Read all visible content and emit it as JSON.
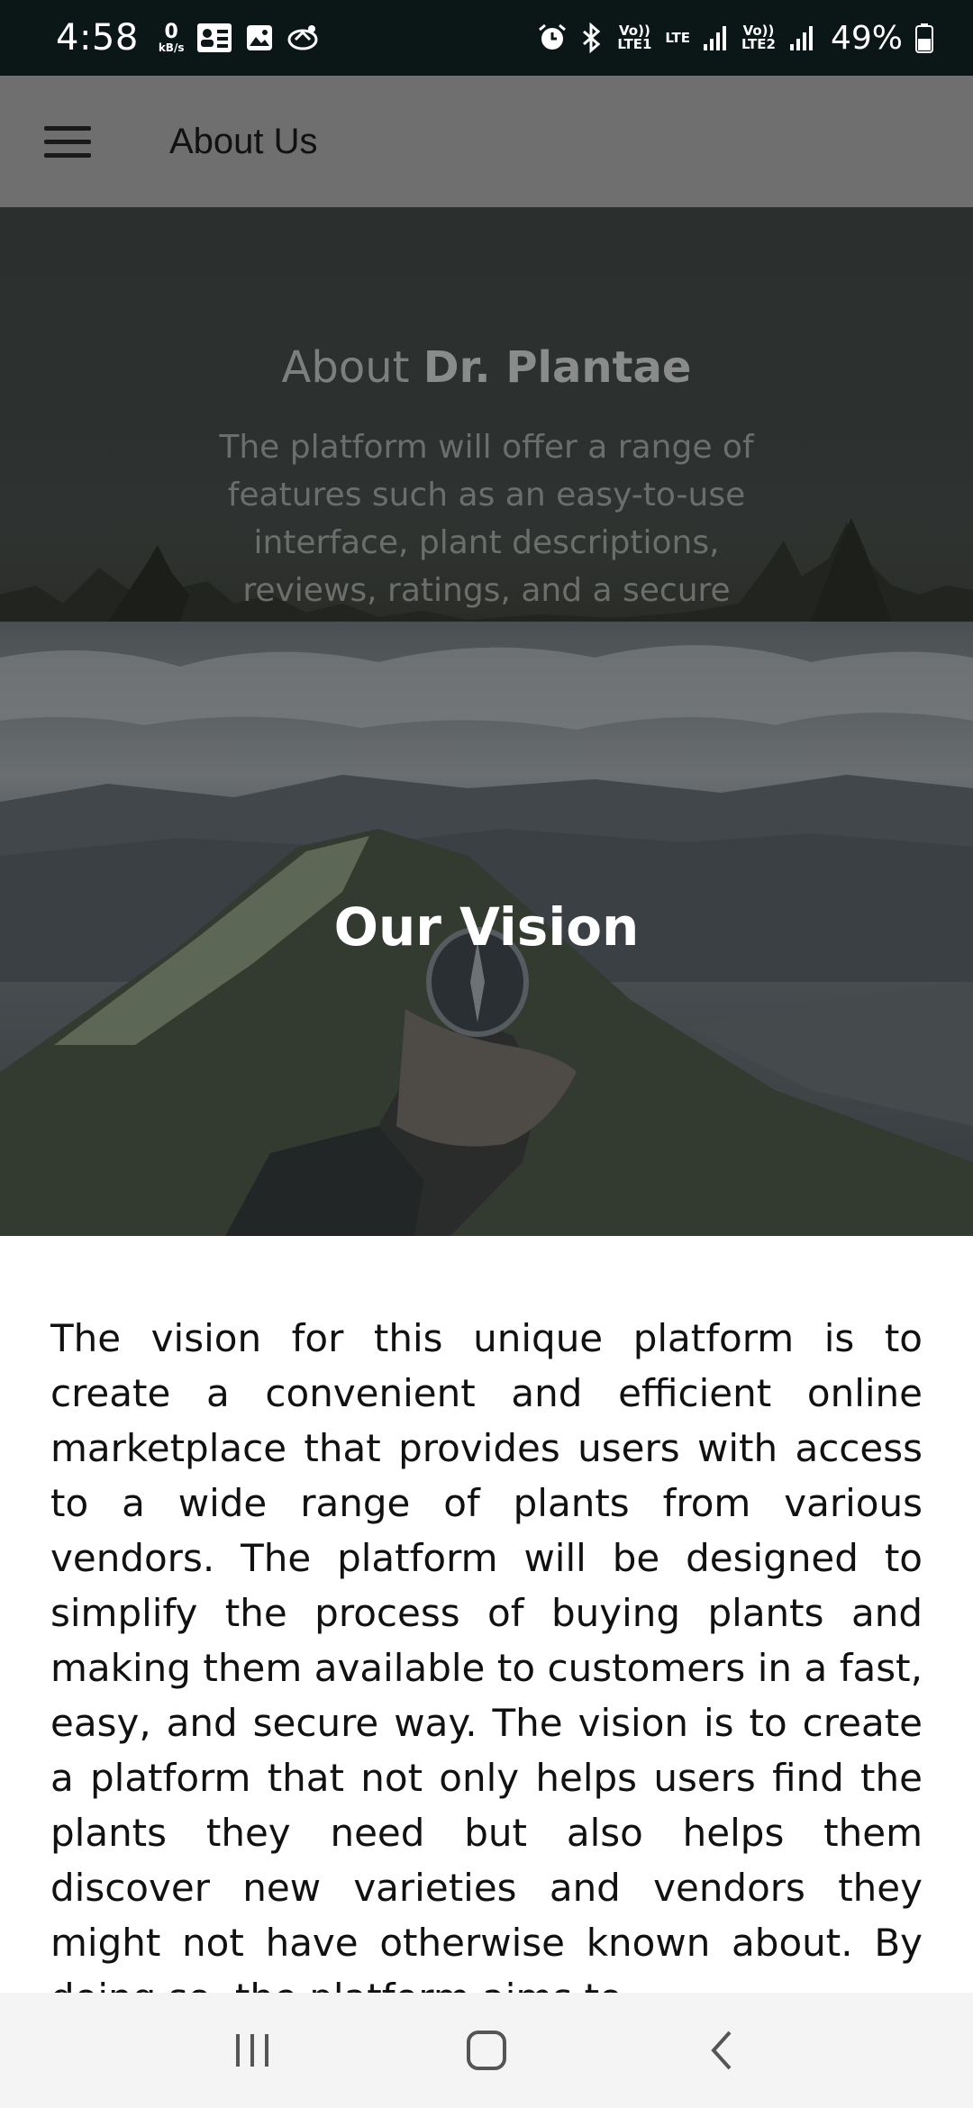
{
  "status_bar": {
    "time": "4:58",
    "speed_value": "0",
    "speed_unit": "kB/s",
    "lte1": "Vo)) LTE1",
    "lte_label": "LTE",
    "lte2": "Vo)) LTE2",
    "battery": "49%"
  },
  "app_bar": {
    "title": "About Us",
    "menu_icon": "hamburger-menu-icon"
  },
  "about_section": {
    "heading_prefix": "About",
    "heading_brand": "Dr. Plantae",
    "description": "The platform will offer a range of features such as an easy-to-use interface, plant descriptions, reviews, ratings, and a secure"
  },
  "vision_section": {
    "title": "Our Vision",
    "body": "The vision for this unique platform is to create a convenient and efficient online marketplace that provides users with access to a wide range of plants from various vendors. The platform will be designed to simplify the process of buying plants and making them available to customers in a fast, easy, and secure way. The vision is to create a platform that not only helps users find the plants they need but also helps them discover new varieties and vendors they might not have otherwise known about. By doing so, the platform aims to"
  },
  "nav_bar": {
    "recents_icon": "recents-icon",
    "home_icon": "home-icon",
    "back_icon": "back-icon"
  },
  "colors": {
    "status_bar": "#0b1616",
    "app_bar": "#6e6f6e",
    "hero_overlay": "#2c302f",
    "text": "#111111"
  }
}
